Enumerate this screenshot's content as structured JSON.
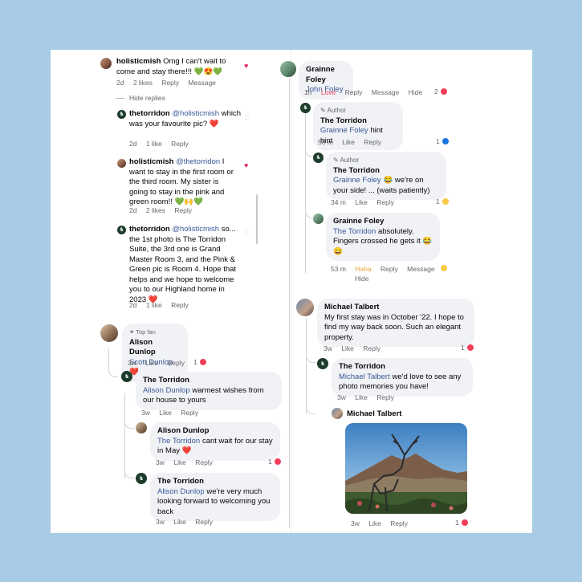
{
  "left": {
    "c1": {
      "user": "holisticmish",
      "text": "Omg I can't wait to come and stay there!!! 💚😍💚",
      "time": "2d",
      "likes": "2 likes",
      "reply": "Reply",
      "message": "Message"
    },
    "hide_replies": "Hide replies",
    "r1": {
      "user": "thetorridon",
      "mention": "@holisticmish",
      "text": "which was your favourite pic? ❤️",
      "time": "2d",
      "likes": "1 like",
      "reply": "Reply"
    },
    "r2": {
      "user": "holisticmish",
      "mention": "@thetorridon",
      "text": "I want to stay in the first room or the third room. My sister is going to stay in the pink and green room!! 💚🙌💚",
      "time": "2d",
      "likes": "2 likes",
      "reply": "Reply"
    },
    "r3": {
      "user": "thetorridon",
      "mention": "@holisticmish",
      "text": "so... the 1st photo is The Torridon Suite, the 3rd one is Grand Master Room 3, and the Pink & Green pic is Room 4. Hope that helps and we hope to welcome you to our Highland home in 2023 ❤️",
      "time": "2d",
      "likes": "1 like",
      "reply": "Reply"
    },
    "fb1": {
      "badge": "Top fan",
      "name": "Alison Dunlop",
      "mention": "Scott Dunlop",
      "text": "❤️",
      "time": "3w",
      "like": "Like",
      "reply": "Reply",
      "count": "1"
    },
    "fb2": {
      "name": "The Torridon",
      "mention": "Alison Dunlop",
      "text": "warmest wishes from our house to yours",
      "time": "3w",
      "like": "Like",
      "reply": "Reply"
    },
    "fb3": {
      "name": "Alison Dunlop",
      "mention": "The Torridon",
      "text": "cant wait for our stay in May ❤️",
      "time": "3w",
      "like": "Like",
      "reply": "Reply",
      "count": "1"
    },
    "fb4": {
      "name": "The Torridon",
      "mention": "Alison Dunlop",
      "text": "we're very much looking forward to welcoming you back",
      "time": "3w",
      "like": "Like",
      "reply": "Reply"
    }
  },
  "right": {
    "g1": {
      "name": "Grainne Foley",
      "mention": "John Foley",
      "time": "1h",
      "love": "Love",
      "reply": "Reply",
      "message": "Message",
      "hide": "Hide",
      "count": "2"
    },
    "g2": {
      "tag": "Author",
      "name": "The Torridon",
      "mention": "Grainne Foley",
      "text": "hint hint",
      "time": "58 m",
      "like": "Like",
      "reply": "Reply",
      "count": "1"
    },
    "g3": {
      "tag": "Author",
      "name": "The Torridon",
      "mention": "Grainne Foley",
      "text": "😂 we're on your side! ... (waits patiently)",
      "time": "34 m",
      "like": "Like",
      "reply": "Reply",
      "count": "1"
    },
    "g4": {
      "name": "Grainne Foley",
      "mention": "The Torridon",
      "text": "absolutely. Fingers crossed he gets it 😂😄",
      "time": "53 m",
      "haha": "Haha",
      "reply": "Reply",
      "message": "Message",
      "hide": "Hide"
    },
    "m1": {
      "name": "Michael Talbert",
      "text": "My first stay was in October '22. I hope to find my way back soon. Such an elegant property.",
      "time": "3w",
      "like": "Like",
      "reply": "Reply",
      "count": "1"
    },
    "m2": {
      "name": "The Torridon",
      "mention": "Michael Talbert",
      "text": "we'd love to see any photo memories you have!",
      "time": "3w",
      "like": "Like",
      "reply": "Reply"
    },
    "m3": {
      "name": "Michael Talbert",
      "time": "3w",
      "like": "Like",
      "reply": "Reply",
      "count": "1"
    }
  },
  "icons": [
    "heart-icon",
    "heart-outline-icon",
    "love-reaction-icon",
    "like-reaction-icon",
    "haha-reaction-icon",
    "pencil-icon",
    "star-icon"
  ],
  "colors": {
    "background": "#a8cbe6",
    "card": "#ffffff",
    "bubble": "#f0f2f5",
    "mention": "#385898",
    "love": "#f33e58",
    "like": "#1b74e4"
  }
}
